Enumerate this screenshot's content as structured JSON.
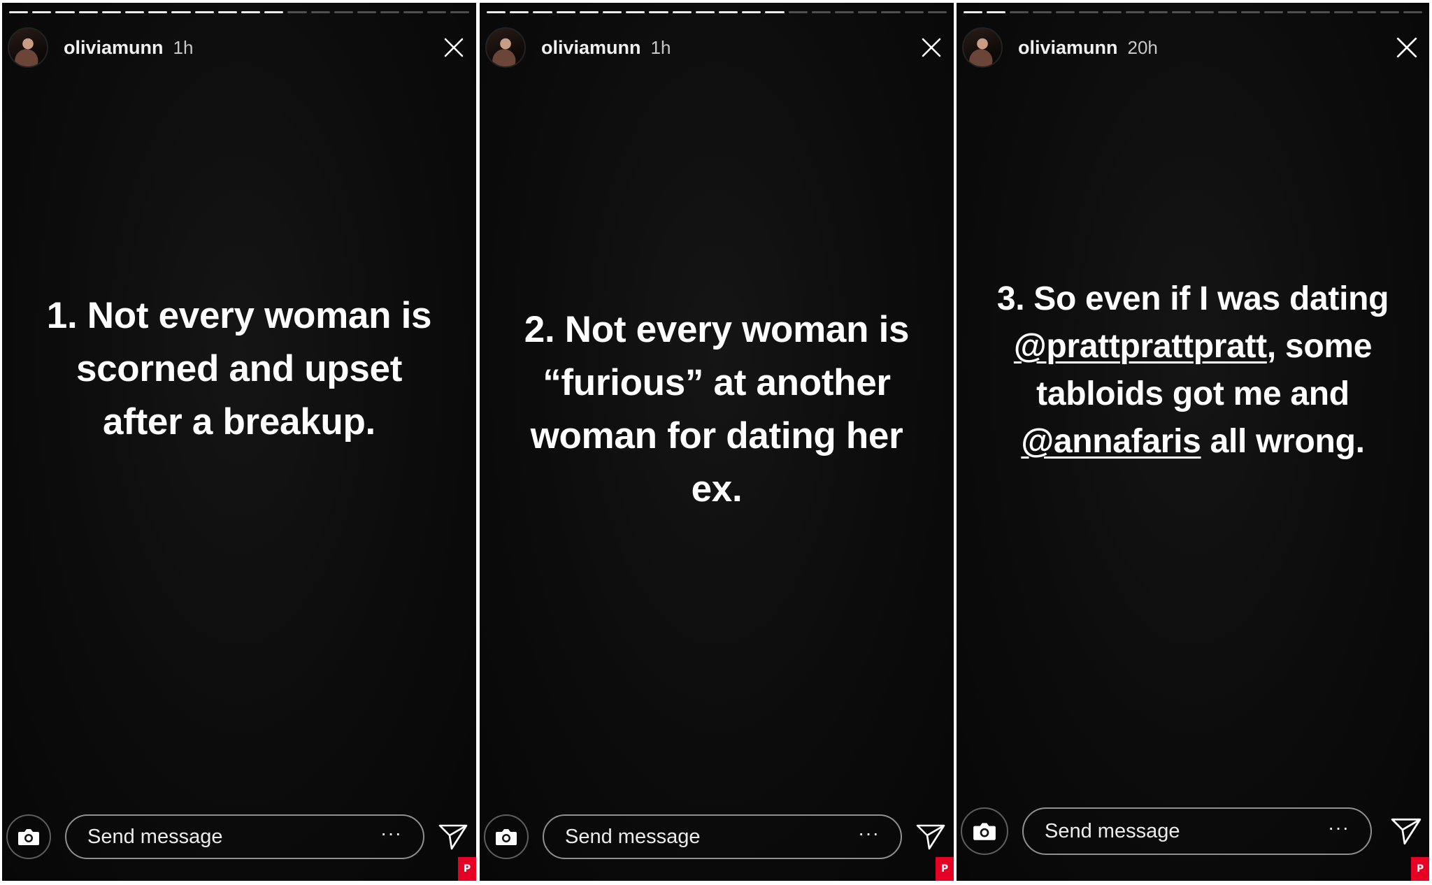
{
  "panels": [
    {
      "username": "oliviamunn",
      "time": "1h",
      "lines": [
        "1. Not every woman is",
        "scorned and upset",
        "after a breakup."
      ],
      "message_placeholder": "Send message",
      "more_label": "···",
      "progress_segments": 20,
      "progress_done": 12
    },
    {
      "username": "oliviamunn",
      "time": "1h",
      "lines": [
        "2. Not every woman is",
        "“furious” at another",
        "woman for dating her",
        "ex."
      ],
      "message_placeholder": "Send message",
      "more_label": "···",
      "progress_segments": 20,
      "progress_done": 13
    },
    {
      "username": "oliviamunn",
      "time": "20h",
      "lines_parts": [
        [
          {
            "text": "3. So even if I was dating"
          }
        ],
        [
          {
            "text": "@prattprattpratt",
            "mention": true
          },
          {
            "text": ", some"
          }
        ],
        [
          {
            "text": "tabloids got me and"
          }
        ],
        [
          {
            "text": "@annafaris",
            "mention": true
          },
          {
            "text": " all wrong."
          }
        ]
      ],
      "message_placeholder": "Send message",
      "more_label": "···",
      "progress_segments": 20,
      "progress_done": 2
    }
  ],
  "icons": {
    "close": "close-icon",
    "camera": "camera-icon",
    "send": "send-icon",
    "more": "more-icon",
    "pinterest": "pinterest-icon"
  },
  "pin_label": "P",
  "colors": {
    "background": "#0a0a0a",
    "text": "#ffffff",
    "pin": "#e60023"
  }
}
